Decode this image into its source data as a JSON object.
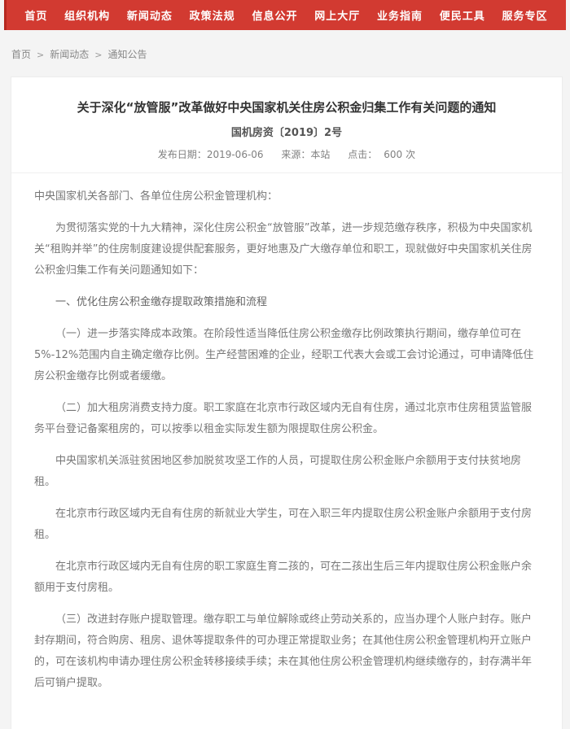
{
  "colors": {
    "nav_bg": "#d23a31",
    "nav_text": "#ffffff",
    "page_bg": "#f4f4f4",
    "card_bg": "#ffffff",
    "title_text": "#333333",
    "body_text": "#777777"
  },
  "nav": {
    "items": [
      "首页",
      "组织机构",
      "新闻动态",
      "政策法规",
      "信息公开",
      "网上大厅",
      "业务指南",
      "便民工具",
      "服务专区"
    ]
  },
  "breadcrumb": {
    "separator": ">",
    "items": [
      "首页",
      "新闻动态",
      "通知公告"
    ]
  },
  "article": {
    "title": "关于深化“放管服”改革做好中央国家机关住房公积金归集工作有关问题的通知",
    "doc_number": "国机房资〔2019〕2号",
    "meta": {
      "publish_label": "发布日期：",
      "publish_date": "2019-06-06",
      "source_label": "来源：",
      "source": "本站",
      "hits_label": "点击：",
      "hits": "600",
      "hits_unit": "次"
    },
    "paragraphs": [
      {
        "type": "address",
        "text": "中央国家机关各部门、各单位住房公积金管理机构："
      },
      {
        "type": "body",
        "text": "为贯彻落实党的十九大精神，深化住房公积金“放管服”改革，进一步规范缴存秩序，积极为中央国家机关“租购并举”的住房制度建设提供配套服务，更好地惠及广大缴存单位和职工，现就做好中央国家机关住房公积金归集工作有关问题通知如下："
      },
      {
        "type": "heading",
        "text": "一、优化住房公积金缴存提取政策措施和流程"
      },
      {
        "type": "body",
        "text": "（一）进一步落实降成本政策。在阶段性适当降低住房公积金缴存比例政策执行期间，缴存单位可在5%-12%范围内自主确定缴存比例。生产经营困难的企业，经职工代表大会或工会讨论通过，可申请降低住房公积金缴存比例或者缓缴。"
      },
      {
        "type": "body",
        "text": "（二）加大租房消费支持力度。职工家庭在北京市行政区域内无自有住房，通过北京市住房租赁监管服务平台登记备案租房的，可以按季以租金实际发生额为限提取住房公积金。"
      },
      {
        "type": "body",
        "text": "中央国家机关派驻贫困地区参加脱贫攻坚工作的人员，可提取住房公积金账户余额用于支付扶贫地房租。"
      },
      {
        "type": "body",
        "text": "在北京市行政区域内无自有住房的新就业大学生，可在入职三年内提取住房公积金账户余额用于支付房租。"
      },
      {
        "type": "body",
        "text": "在北京市行政区域内无自有住房的职工家庭生育二孩的，可在二孩出生后三年内提取住房公积金账户余额用于支付房租。"
      },
      {
        "type": "body",
        "text": "（三）改进封存账户提取管理。缴存职工与单位解除或终止劳动关系的，应当办理个人账户封存。账户封存期间，符合购房、租房、退休等提取条件的可办理正常提取业务；在其他住房公积金管理机构开立账户的，可在该机构申请办理住房公积金转移接续手续；未在其他住房公积金管理机构继续缴存的，封存满半年后可销户提取。"
      }
    ]
  }
}
